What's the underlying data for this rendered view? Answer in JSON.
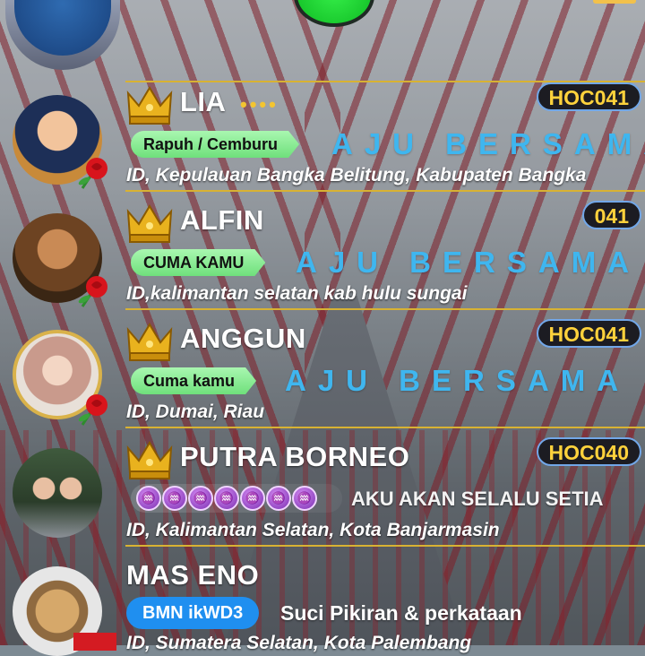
{
  "colors": {
    "accent_line": "#d8b233",
    "code_text": "#ffd23c",
    "code_border": "#72a7e8",
    "marquee_blue": "#3fb6ef",
    "tag_green": "#6fe07c",
    "bmn_blue": "#1f8ff0",
    "gem_purple": "#7a2fb2"
  },
  "rows": [
    {
      "name": "LIA",
      "dots": "••••",
      "code": "HOC041",
      "tag": "Rapuh / Cemburu",
      "marquee": "AJU BERSAMA",
      "location": "ID, Kepulauan Bangka Belitung, Kabupaten Bangka",
      "avatar_icon": "woman-hijab-avatar",
      "badge_icon": "red-rose-icon"
    },
    {
      "name": "ALFIN",
      "code": "041",
      "tag": "CUMA KAMU",
      "marquee": "AJU BERSAMA B",
      "location": "ID,kalimantan selatan kab hulu sungai",
      "avatar_icon": "man-traditional-avatar",
      "badge_icon": "red-rose-icon"
    },
    {
      "name": "ANGGUN",
      "code": "HOC041",
      "tag": "Cuma kamu",
      "marquee": "AJU BERSAMA BI",
      "location": "ID, Dumai, Riau",
      "avatar_icon": "woman-hijab-framed-avatar",
      "badge_icon": "red-rose-icon"
    },
    {
      "name": "PUTRA BORNEO",
      "code": "HOC040",
      "gems": [
        "♒",
        "♒",
        "♒",
        "♒",
        "♒",
        "♒",
        "♒"
      ],
      "status": "AKU AKAN SELALU SETIA",
      "location": "ID, Kalimantan Selatan, Kota Banjarmasin",
      "avatar_icon": "couple-uniform-avatar"
    },
    {
      "name": "MAS  ENO",
      "badge": "BMN  ikWD3",
      "status": "Suci Pikiran & perkataan",
      "location": "ID, Sumatera Selatan, Kota Palembang",
      "avatar_icon": "winged-emblem-avatar"
    }
  ]
}
